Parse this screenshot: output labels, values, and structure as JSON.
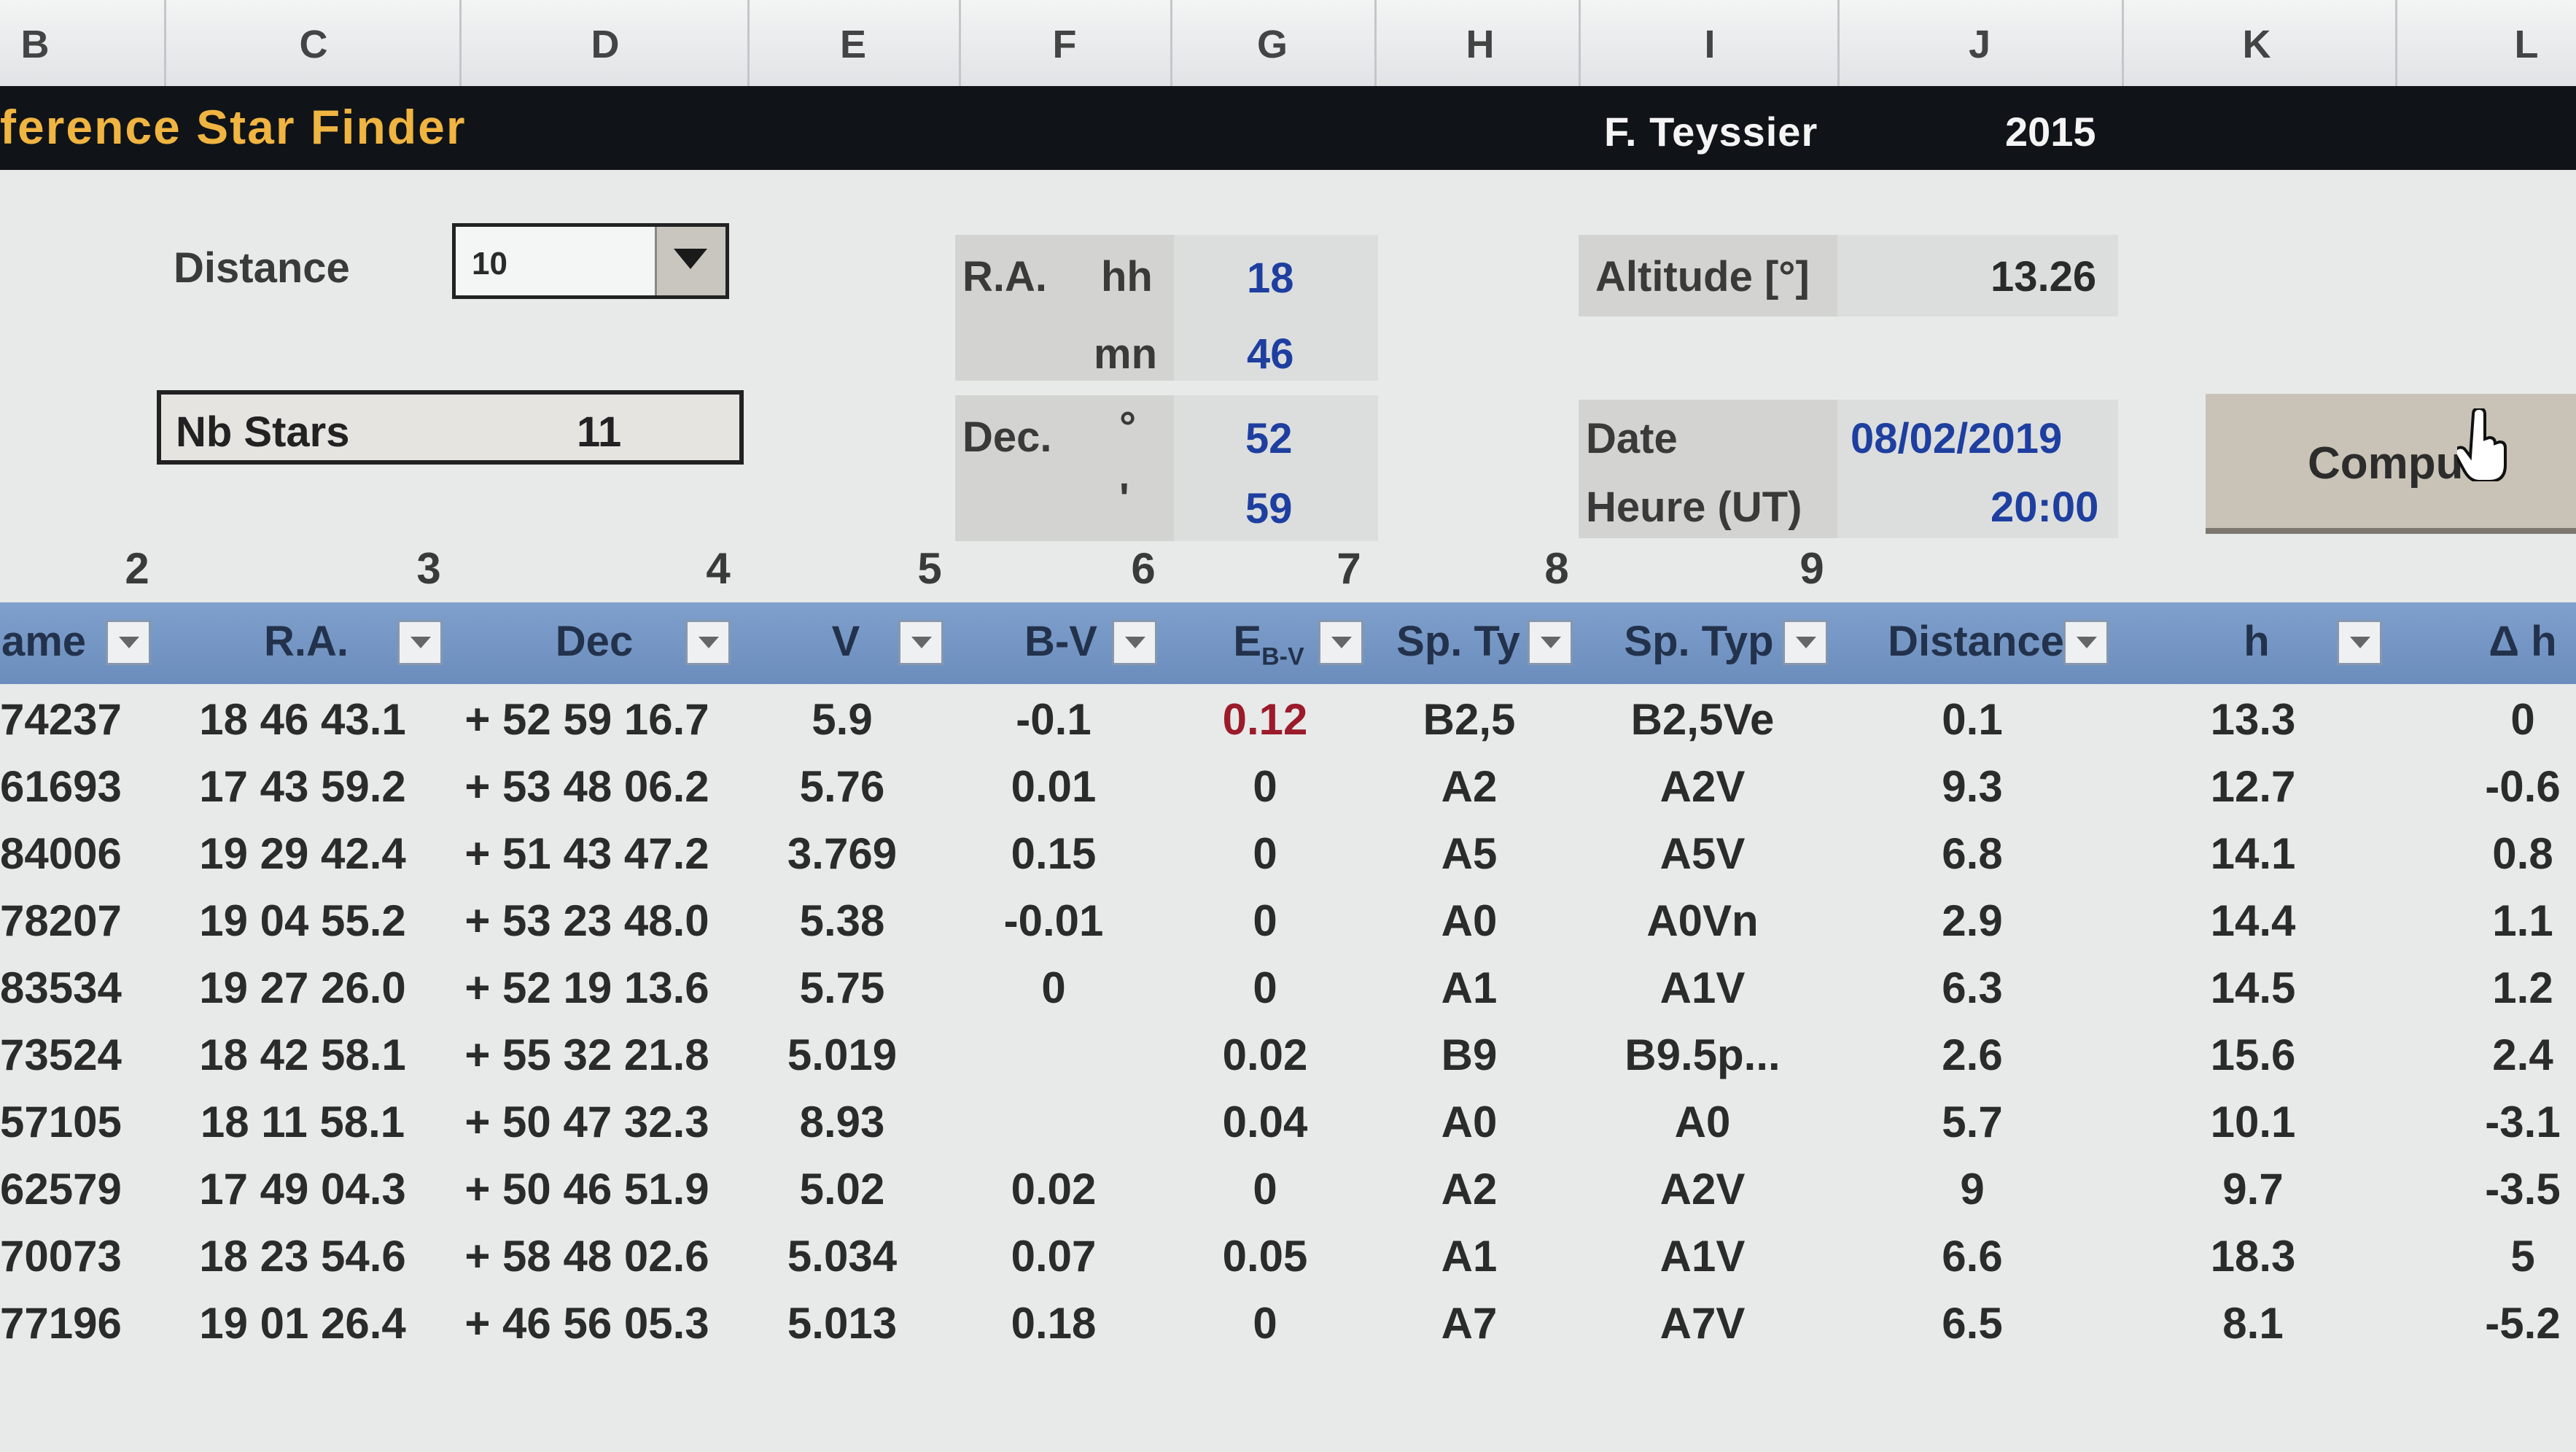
{
  "column_letters": [
    "B",
    "C",
    "D",
    "E",
    "F",
    "G",
    "H",
    "I",
    "J",
    "K",
    "L"
  ],
  "banner": {
    "title": "ference Star Finder",
    "author": "F. Teyssier",
    "year": "2015"
  },
  "distance": {
    "label": "Distance",
    "value": "10"
  },
  "nb_stars": {
    "label": "Nb Stars",
    "value": "11"
  },
  "ra": {
    "label": "R.A.",
    "hh_label": "hh",
    "hh": "18",
    "mn_label": "mn",
    "mn": "46"
  },
  "dec": {
    "label": "Dec.",
    "deg_label": "°",
    "deg": "52",
    "min_label": "'",
    "min": "59"
  },
  "altitude": {
    "label": "Altitude [°]",
    "value": "13.26"
  },
  "date": {
    "label": "Date",
    "value": "08/02/2019"
  },
  "time": {
    "label": "Heure (UT)",
    "value": "20:00"
  },
  "compute_button": {
    "label": "Compu"
  },
  "column_numbers": [
    "2",
    "3",
    "4",
    "5",
    "6",
    "7",
    "8",
    "9"
  ],
  "table": {
    "headers": {
      "name": "ame",
      "ra": "R.A.",
      "dec": "Dec",
      "v": "V",
      "bv": "B-V",
      "ebv_main": "E",
      "ebv_sub": "B-V",
      "sptype1": "Sp. Ty",
      "sptype2": "Sp. Typ",
      "distance": "Distance",
      "h": "h",
      "dh": "Δ h"
    },
    "rows": [
      {
        "name": "74237",
        "ra": "18 46 43.1",
        "dec": "+ 52 59 16.7",
        "v": "5.9",
        "bv": "-0.1",
        "ebv": "0.12",
        "sp1": "B2,5",
        "sp2": "B2,5Ve",
        "dist": "0.1",
        "h": "13.3",
        "dh": "0"
      },
      {
        "name": "61693",
        "ra": "17 43 59.2",
        "dec": "+ 53 48 06.2",
        "v": "5.76",
        "bv": "0.01",
        "ebv": "0",
        "sp1": "A2",
        "sp2": "A2V",
        "dist": "9.3",
        "h": "12.7",
        "dh": "-0.6"
      },
      {
        "name": "84006",
        "ra": "19 29 42.4",
        "dec": "+ 51 43 47.2",
        "v": "3.769",
        "bv": "0.15",
        "ebv": "0",
        "sp1": "A5",
        "sp2": "A5V",
        "dist": "6.8",
        "h": "14.1",
        "dh": "0.8"
      },
      {
        "name": "78207",
        "ra": "19 04 55.2",
        "dec": "+ 53 23 48.0",
        "v": "5.38",
        "bv": "-0.01",
        "ebv": "0",
        "sp1": "A0",
        "sp2": "A0Vn",
        "dist": "2.9",
        "h": "14.4",
        "dh": "1.1"
      },
      {
        "name": "83534",
        "ra": "19 27 26.0",
        "dec": "+ 52 19 13.6",
        "v": "5.75",
        "bv": "0",
        "ebv": "0",
        "sp1": "A1",
        "sp2": "A1V",
        "dist": "6.3",
        "h": "14.5",
        "dh": "1.2"
      },
      {
        "name": "73524",
        "ra": "18 42 58.1",
        "dec": "+ 55 32 21.8",
        "v": "5.019",
        "bv": "",
        "ebv": "0.02",
        "sp1": "B9",
        "sp2": "B9.5p...",
        "dist": "2.6",
        "h": "15.6",
        "dh": "2.4"
      },
      {
        "name": "57105",
        "ra": "18 11 58.1",
        "dec": "+ 50 47 32.3",
        "v": "8.93",
        "bv": "",
        "ebv": "0.04",
        "sp1": "A0",
        "sp2": "A0",
        "dist": "5.7",
        "h": "10.1",
        "dh": "-3.1"
      },
      {
        "name": "62579",
        "ra": "17 49 04.3",
        "dec": "+ 50 46 51.9",
        "v": "5.02",
        "bv": "0.02",
        "ebv": "0",
        "sp1": "A2",
        "sp2": "A2V",
        "dist": "9",
        "h": "9.7",
        "dh": "-3.5"
      },
      {
        "name": "70073",
        "ra": "18 23 54.6",
        "dec": "+ 58 48 02.6",
        "v": "5.034",
        "bv": "0.07",
        "ebv": "0.05",
        "sp1": "A1",
        "sp2": "A1V",
        "dist": "6.6",
        "h": "18.3",
        "dh": "5"
      },
      {
        "name": "77196",
        "ra": "19 01 26.4",
        "dec": "+ 46 56 05.3",
        "v": "5.013",
        "bv": "0.18",
        "ebv": "0",
        "sp1": "A7",
        "sp2": "A7V",
        "dist": "6.5",
        "h": "8.1",
        "dh": "-5.2"
      }
    ]
  },
  "colors": {
    "accent_title": "#f0b441",
    "header_blue": "#7fa0cc",
    "value_blue": "#1e3fa0",
    "red_value": "#9b1b2b"
  }
}
